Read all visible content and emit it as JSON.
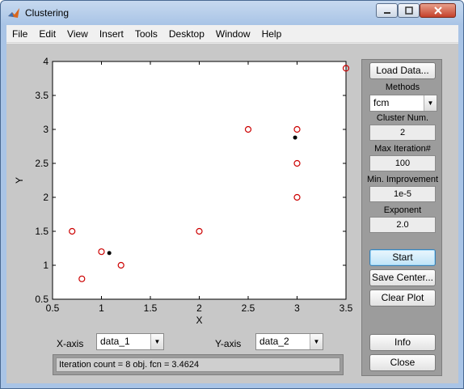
{
  "window": {
    "title": "Clustering"
  },
  "menu": [
    "File",
    "Edit",
    "View",
    "Insert",
    "Tools",
    "Desktop",
    "Window",
    "Help"
  ],
  "controls": {
    "x_axis_label": "X-axis",
    "x_axis_value": "data_1",
    "y_axis_label": "Y-axis",
    "y_axis_value": "data_2",
    "status": "Iteration count = 8 obj. fcn = 3.4624"
  },
  "panel": {
    "load_data": "Load Data...",
    "methods_label": "Methods",
    "method_value": "fcm",
    "cluster_num_label": "Cluster Num.",
    "cluster_num_value": "2",
    "max_iter_label": "Max Iteration#",
    "max_iter_value": "100",
    "min_improve_label": "Min. Improvement",
    "min_improve_value": "1e-5",
    "exponent_label": "Exponent",
    "exponent_value": "2.0",
    "start": "Start",
    "save_center": "Save Center...",
    "clear_plot": "Clear Plot",
    "info": "Info",
    "close": "Close"
  },
  "chart_data": {
    "type": "scatter",
    "xlabel": "X",
    "ylabel": "Y",
    "xlim": [
      0.5,
      3.5
    ],
    "ylim": [
      0.5,
      4
    ],
    "xticks": [
      0.5,
      1,
      1.5,
      2,
      2.5,
      3,
      3.5
    ],
    "yticks": [
      0.5,
      1,
      1.5,
      2,
      2.5,
      3,
      3.5,
      4
    ],
    "series": [
      {
        "x": [
          0.7,
          0.8,
          1.0,
          1.2,
          2.0,
          2.5,
          3.0,
          3.0,
          3.0,
          3.5
        ],
        "y": [
          1.5,
          0.8,
          1.2,
          1.0,
          1.5,
          3.0,
          3.0,
          2.5,
          2.0,
          3.9
        ],
        "color": "#cc0000"
      },
      {
        "x": [
          1.08,
          2.98
        ],
        "y": [
          1.18,
          2.88
        ],
        "color": "#000000"
      }
    ]
  }
}
